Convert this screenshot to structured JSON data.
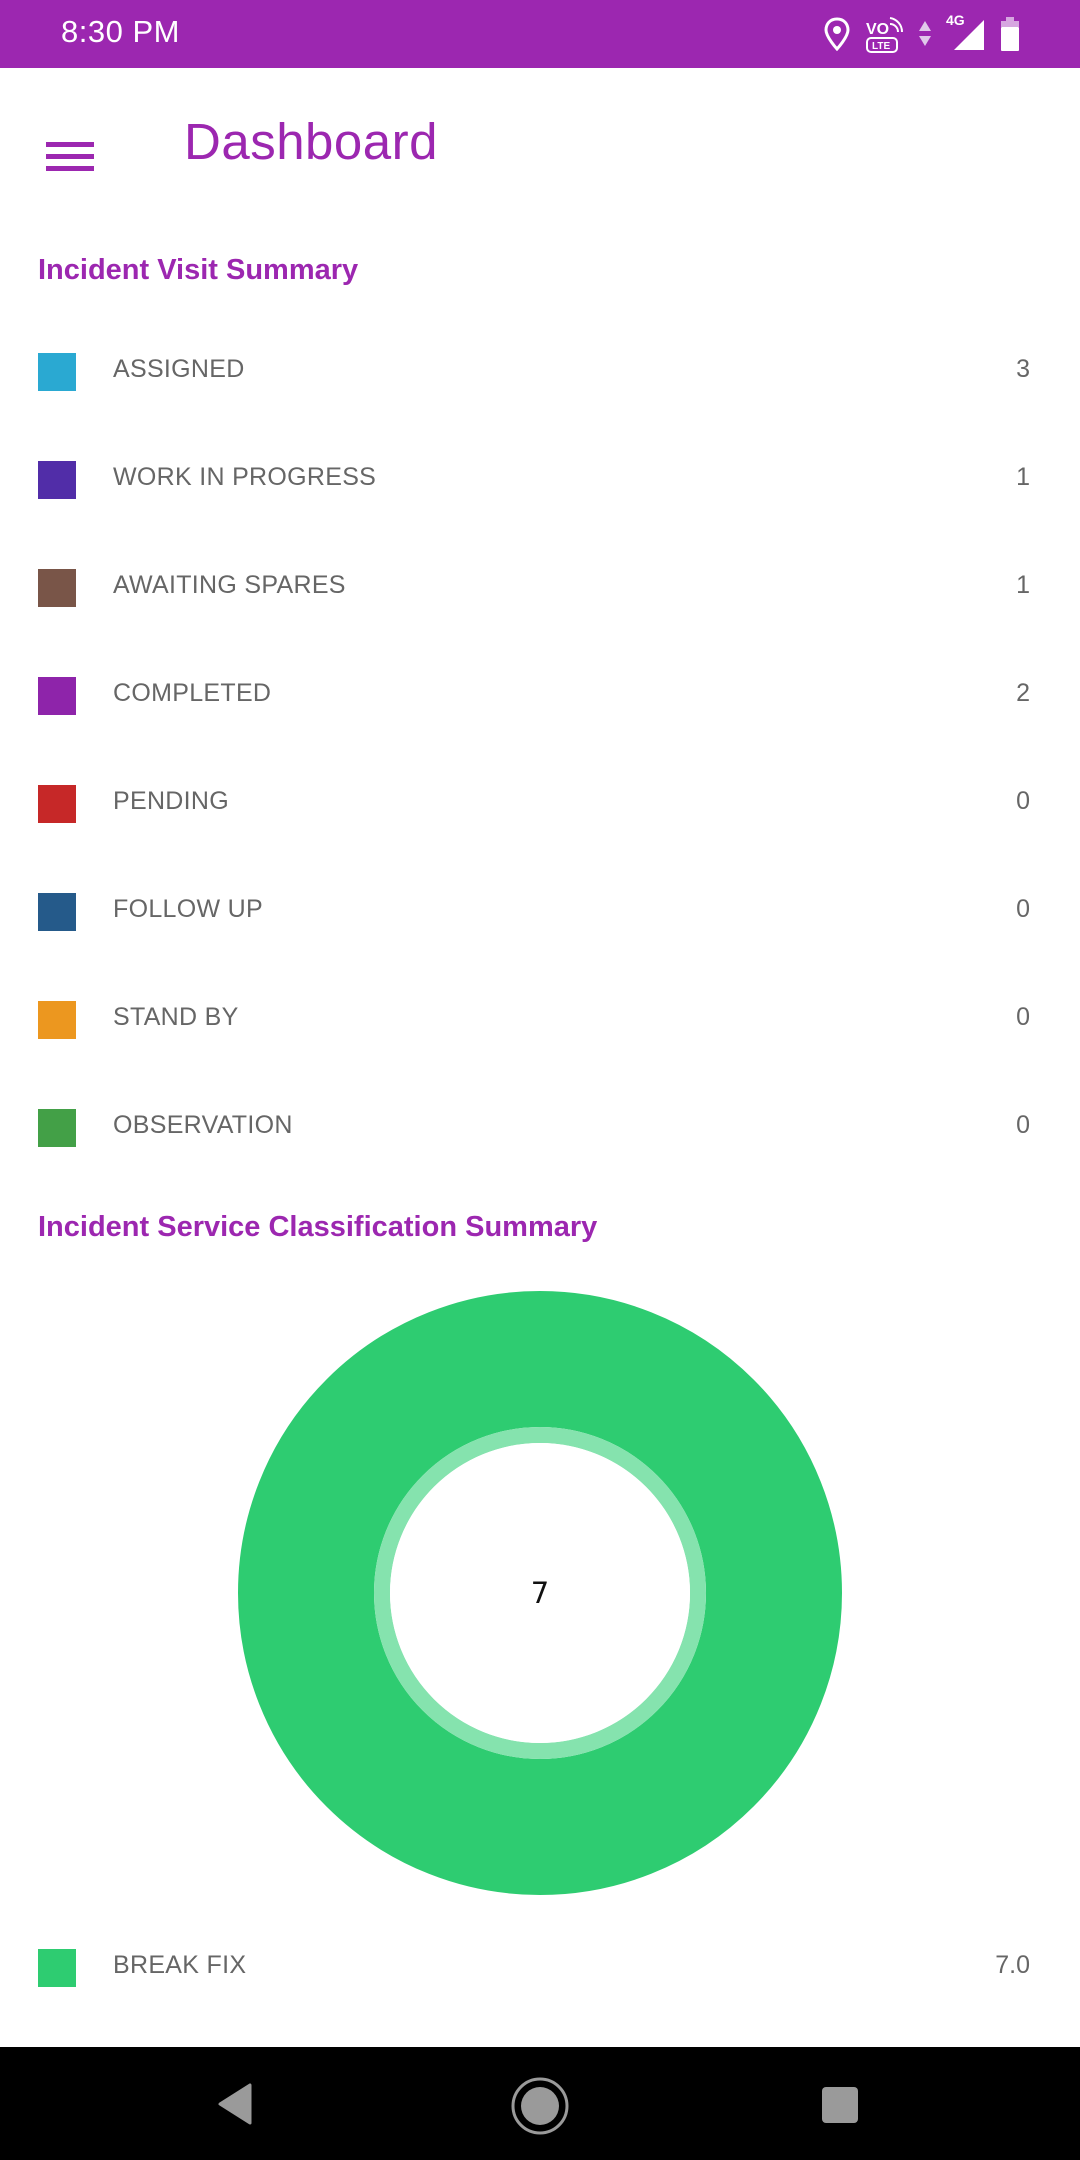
{
  "status_bar": {
    "time": "8:30 PM",
    "icons": [
      "location-icon",
      "volte-icon",
      "data-arrows-icon",
      "4g-icon",
      "signal-icon",
      "battery-icon"
    ],
    "network_label": "4G",
    "volte_label": "VO",
    "lte_label": "LTE"
  },
  "header": {
    "menu_icon": "hamburger-menu-icon",
    "title": "Dashboard"
  },
  "colors": {
    "accent": "#9c27b0",
    "text_secondary": "#666666"
  },
  "visit_summary": {
    "title": "Incident Visit Summary",
    "items": [
      {
        "label": "ASSIGNED",
        "value": "3",
        "color": "#2aa9d2"
      },
      {
        "label": "WORK IN PROGRESS",
        "value": "1",
        "color": "#512da8"
      },
      {
        "label": "AWAITING SPARES",
        "value": "1",
        "color": "#795548"
      },
      {
        "label": "COMPLETED",
        "value": "2",
        "color": "#8e24aa"
      },
      {
        "label": "PENDING",
        "value": "0",
        "color": "#c62828"
      },
      {
        "label": "FOLLOW UP",
        "value": "0",
        "color": "#255a8a"
      },
      {
        "label": "STAND BY",
        "value": "0",
        "color": "#ec971f"
      },
      {
        "label": "OBSERVATION",
        "value": "0",
        "color": "#43a047"
      }
    ]
  },
  "classification_summary": {
    "title": "Incident Service Classification Summary",
    "center_label": "7",
    "items": [
      {
        "label": "BREAK FIX",
        "value": "7.0",
        "color": "#2ecc71"
      }
    ]
  },
  "chart_data": {
    "type": "pie",
    "variant": "donut",
    "title": "Incident Service Classification Summary",
    "categories": [
      "BREAK FIX"
    ],
    "values": [
      7.0
    ],
    "colors": [
      "#2ecc71"
    ],
    "center_text": "7",
    "legend_position": "bottom"
  },
  "nav_bar": {
    "buttons": [
      "back-icon",
      "home-icon",
      "recents-icon"
    ]
  }
}
